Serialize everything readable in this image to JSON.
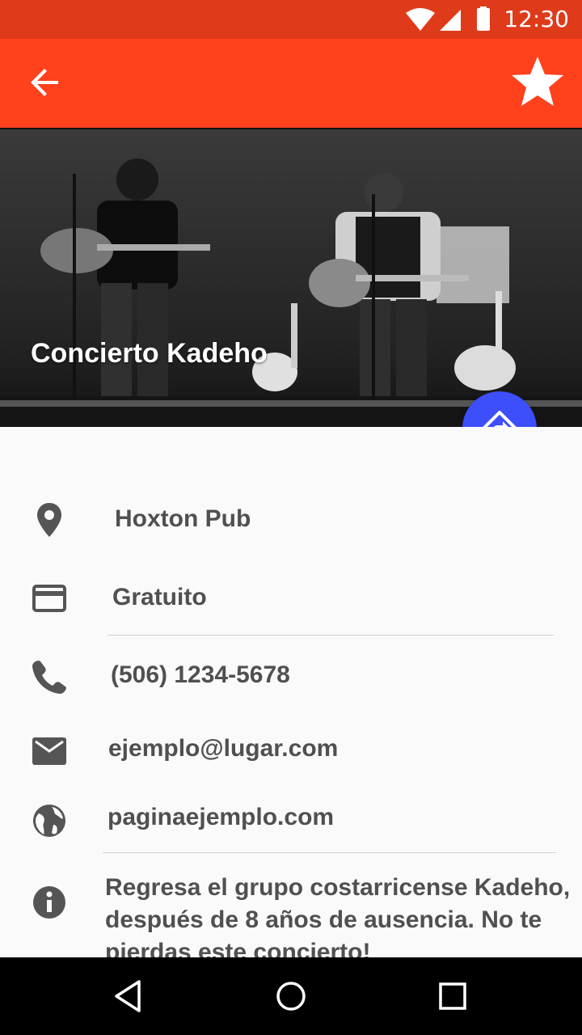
{
  "status_bar": {
    "time": "12:30"
  },
  "colors": {
    "app_bar": "#ff411c",
    "status_bar": "#df3b1a",
    "fab": "#3d4efb",
    "text": "#505050"
  },
  "header": {
    "back_icon": "arrow-back-icon",
    "favorite_icon": "star-icon"
  },
  "event": {
    "title": "Concierto Kadeho",
    "directions_icon": "directions-icon",
    "venue": "Hoxton Pub",
    "price": "Gratuito",
    "phone": "(506) 1234-5678",
    "email": "ejemplo@lugar.com",
    "website": "paginaejemplo.com",
    "description": "Regresa el grupo costarricense Kadeho, después de 8 años de ausencia. No te pierdas este concierto!"
  },
  "icons": {
    "venue": "location-pin-icon",
    "price": "credit-card-icon",
    "phone": "phone-icon",
    "email": "email-icon",
    "website": "globe-icon",
    "description": "info-icon"
  },
  "nav": {
    "back": "nav-back-icon",
    "home": "nav-home-icon",
    "recents": "nav-recents-icon"
  }
}
